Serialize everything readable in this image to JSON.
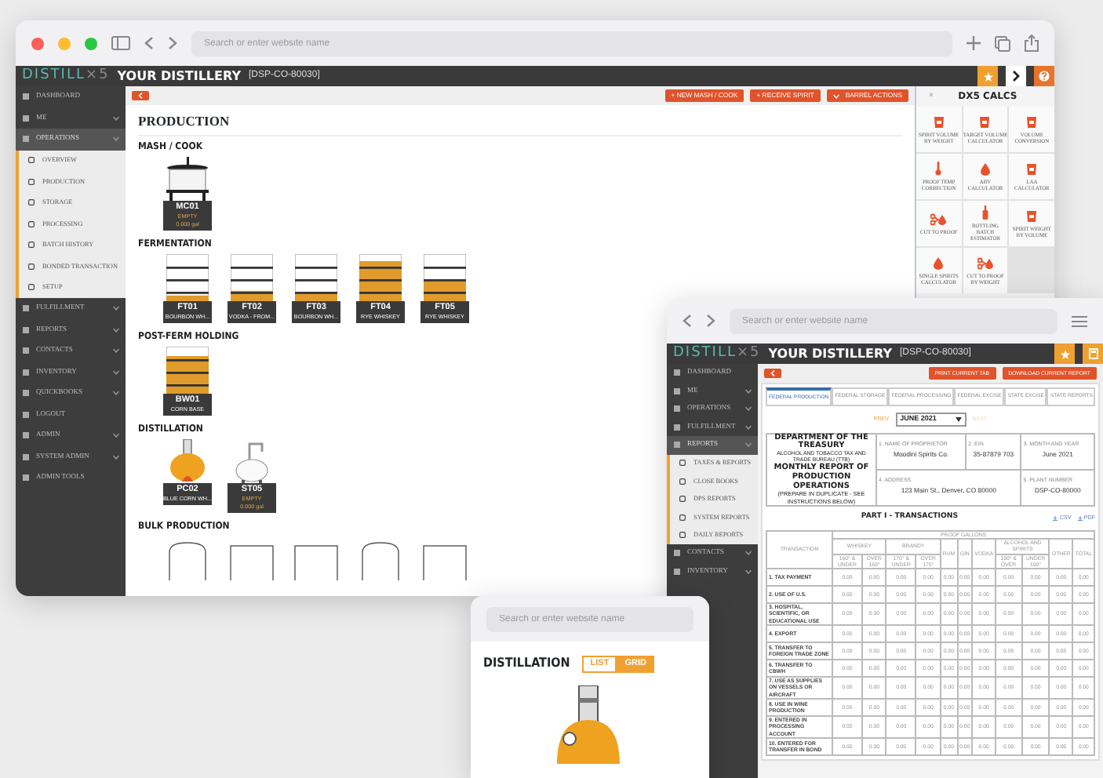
{
  "main_window": {
    "browser": {
      "search_placeholder": "Search or enter website name"
    },
    "header": {
      "logo_word": "DISTILL",
      "logo_suffix": "×5",
      "title": "YOUR DISTILLERY",
      "code": "[DSP-CO-80030]"
    },
    "sidebar": [
      {
        "label": "DASHBOARD",
        "expandable": false,
        "selected": false
      },
      {
        "label": "ME",
        "expandable": true,
        "selected": false
      },
      {
        "label": "OPERATIONS",
        "expandable": true,
        "selected": true,
        "children": [
          {
            "label": "OVERVIEW"
          },
          {
            "label": "PRODUCTION"
          },
          {
            "label": "STORAGE"
          },
          {
            "label": "PROCESSING"
          },
          {
            "label": "BATCH HISTORY"
          },
          {
            "label": "BONDED TRANSACTION"
          },
          {
            "label": "SETUP"
          }
        ]
      },
      {
        "label": "FULFILLMENT",
        "expandable": true,
        "selected": false
      },
      {
        "label": "REPORTS",
        "expandable": true,
        "selected": false
      },
      {
        "label": "CONTACTS",
        "expandable": true,
        "selected": false
      },
      {
        "label": "INVENTORY",
        "expandable": true,
        "selected": false
      },
      {
        "label": "QUICKBOOKS",
        "expandable": true,
        "selected": false
      },
      {
        "label": "LOGOUT",
        "expandable": false,
        "selected": false
      },
      {
        "label": "ADMIN",
        "expandable": true,
        "selected": false
      },
      {
        "label": "SYSTEM ADMIN",
        "expandable": true,
        "selected": false
      },
      {
        "label": "ADMIN TOOLS",
        "expandable": false,
        "selected": false
      }
    ],
    "toolbar": [
      {
        "label": "+ NEW MASH / COOK",
        "kind": "plain"
      },
      {
        "label": "+ RECEIVE SPIRIT",
        "kind": "plain"
      },
      {
        "label": "BARREL ACTIONS",
        "kind": "dropdown"
      }
    ],
    "heading": "PRODUCTION",
    "sections": [
      {
        "title": "MASH / COOK",
        "vessels": [
          {
            "kind": "mash",
            "name": "MC01",
            "lines": [
              "EMPTY",
              "0.000 gal"
            ]
          }
        ]
      },
      {
        "title": "FERMENTATION",
        "vessels": [
          {
            "kind": "fermenter",
            "name": "FT01",
            "lines": [
              "BOURBON WH..."
            ],
            "level": 0.12
          },
          {
            "kind": "fermenter",
            "name": "FT02",
            "lines": [
              "VODKA - FROM..."
            ],
            "level": 0.22
          },
          {
            "kind": "fermenter",
            "name": "FT03",
            "lines": [
              "BOURBON WH..."
            ],
            "level": 0.2
          },
          {
            "kind": "fermenter",
            "name": "FT04",
            "lines": [
              "RYE WHISKEY"
            ],
            "level": 0.85
          },
          {
            "kind": "fermenter",
            "name": "FT05",
            "lines": [
              "RYE WHISKEY"
            ],
            "level": 0.45
          }
        ]
      },
      {
        "title": "POST-FERM HOLDING",
        "vessels": [
          {
            "kind": "fermenter",
            "name": "BW01",
            "lines": [
              "CORN BASE"
            ],
            "level": 0.8
          }
        ]
      },
      {
        "title": "DISTILLATION",
        "vessels": [
          {
            "kind": "pot_still",
            "name": "PC02",
            "lines": [
              "BLUE CORN WH..."
            ]
          },
          {
            "kind": "column_still",
            "name": "ST05",
            "lines": [
              "EMPTY",
              "0.000 gal"
            ]
          }
        ]
      },
      {
        "title": "BULK PRODUCTION",
        "vessels": [
          {
            "kind": "round_tank"
          },
          {
            "kind": "square_tank"
          },
          {
            "kind": "square_tank"
          },
          {
            "kind": "round_tank"
          },
          {
            "kind": "square_tank"
          }
        ]
      }
    ],
    "calcs": {
      "title": "DX5 CALCS",
      "close": "×",
      "items": [
        {
          "label": "SPIRIT VOLUME BY WEIGHT",
          "kind": "glass"
        },
        {
          "label": "TARGET VOLUME CALCULATOR",
          "kind": "glass"
        },
        {
          "label": "VOLUME CONVERSION",
          "kind": "glass"
        },
        {
          "label": "PROOF TEMP CORRECTION",
          "kind": "thermometer"
        },
        {
          "label": "ABV CALCULATOR",
          "kind": "drop"
        },
        {
          "label": "LAA CALCULATOR",
          "kind": "glass"
        },
        {
          "label": "CUT TO PROOF",
          "kind": "scissors"
        },
        {
          "label": "BOTTLING BATCH ESTIMATOR",
          "kind": "bottle"
        },
        {
          "label": "SPIRIT WEIGHT BY VOLUME",
          "kind": "glass"
        },
        {
          "label": "SINGLE SPIRITS CALCULATOR",
          "kind": "drop"
        },
        {
          "label": "CUT TO PROOF BY WEIGHT",
          "kind": "scissors"
        }
      ]
    }
  },
  "report_window": {
    "browser": {
      "search_placeholder": "Search or enter website name"
    },
    "header": {
      "logo_word": "DISTILL",
      "logo_suffix": "×5",
      "title": "YOUR DISTILLERY",
      "code": "[DSP-CO-80030]"
    },
    "sidebar": [
      {
        "label": "DASHBOARD",
        "expandable": false,
        "selected": false
      },
      {
        "label": "ME",
        "expandable": true,
        "selected": false
      },
      {
        "label": "OPERATIONS",
        "expandable": true,
        "selected": false
      },
      {
        "label": "FULFILLMENT",
        "expandable": true,
        "selected": false
      },
      {
        "label": "REPORTS",
        "expandable": true,
        "selected": true,
        "children": [
          {
            "label": "TAXES & REPORTS"
          },
          {
            "label": "CLOSE BOOKS"
          },
          {
            "label": "DPS REPORTS"
          },
          {
            "label": "SYSTEM REPORTS"
          },
          {
            "label": "DAILY REPORTS"
          }
        ]
      },
      {
        "label": "CONTACTS",
        "expandable": true,
        "selected": false
      },
      {
        "label": "INVENTORY",
        "expandable": true,
        "selected": false
      }
    ],
    "buttons": [
      "PRINT CURRENT TAB",
      "DOWNLOAD CURRENT REPORT"
    ],
    "tabs": [
      {
        "label": "FEDERAL PRODUCTION",
        "selected": true
      },
      {
        "label": "FEDERAL STORAGE",
        "selected": false
      },
      {
        "label": "FEDERAL PROCESSING",
        "selected": false
      },
      {
        "label": "FEDERAL EXCISE",
        "selected": false
      },
      {
        "label": "STATE EXCISE",
        "selected": false
      },
      {
        "label": "STATE REPORTS",
        "selected": false
      }
    ],
    "period": {
      "prev": "PREV",
      "value": "JUNE 2021",
      "next": "NEXT"
    },
    "form": {
      "agency": "DEPARTMENT OF THE TREASURY",
      "bureau": "ALCOHOL AND TOBACCO TAX AND TRADE BUREAU (TTB)",
      "title": "MONTHLY REPORT OF PRODUCTION OPERATIONS",
      "note": "(PREPARE IN DUPLICATE - SEE INSTRUCTIONS BELOW)",
      "fields": [
        {
          "label": "1. NAME OF PROPRIETOR",
          "value": "Moodini Spirits Co."
        },
        {
          "label": "2. EIN",
          "value": "35-87879 703"
        },
        {
          "label": "3. MONTH AND YEAR",
          "value": "June 2021"
        },
        {
          "label": "4. ADDRESS",
          "value": "123 Main St., Denver, CO 80000"
        },
        {
          "label": "5. PLANT NUMBER",
          "value": "DSP-CO-80000"
        }
      ]
    },
    "part_title": "PART I - TRANSACTIONS",
    "exports": [
      "CSV",
      "PDF"
    ],
    "table": {
      "group": "PROOF GALLONS",
      "first_column": "TRANSACTION",
      "columns": [
        {
          "label": "WHISKEY",
          "sub": [
            "160° & UNDER",
            "OVER 160°"
          ]
        },
        {
          "label": "BRANDY",
          "sub": [
            "170° & UNDER",
            "OVER 170°"
          ]
        },
        {
          "label": "RUM"
        },
        {
          "label": "GIN"
        },
        {
          "label": "VODKA"
        },
        {
          "label": "ALCOHOL AND SPIRITS",
          "sub": [
            "190° & OVER",
            "UNDER 190°"
          ]
        },
        {
          "label": "OTHER"
        },
        {
          "label": "TOTAL"
        }
      ],
      "rows": [
        {
          "label": "1. TAX PAYMENT",
          "values": [
            "0.00",
            "0.00",
            "0.00",
            "0.00",
            "0.00",
            "0.00",
            "0.00",
            "0.00",
            "0.00",
            "0.00",
            "0.00"
          ]
        },
        {
          "label": "2. USE OF U.S.",
          "values": [
            "0.00",
            "0.00",
            "0.00",
            "0.00",
            "0.00",
            "0.00",
            "0.00",
            "0.00",
            "0.00",
            "0.00",
            "0.00"
          ]
        },
        {
          "label": "3. HOSPITAL, SCIENTIFIC, OR EDUCATIONAL USE",
          "values": [
            "0.00",
            "0.00",
            "0.00",
            "0.00",
            "0.00",
            "0.00",
            "0.00",
            "0.00",
            "0.00",
            "0.00",
            "0.00"
          ]
        },
        {
          "label": "4. EXPORT",
          "values": [
            "0.00",
            "0.00",
            "0.00",
            "0.00",
            "0.00",
            "0.00",
            "0.00",
            "0.00",
            "0.00",
            "0.00",
            "0.00"
          ]
        },
        {
          "label": "5. TRANSFER TO FOREIGN TRADE ZONE",
          "values": [
            "0.00",
            "0.00",
            "0.00",
            "0.00",
            "0.00",
            "0.00",
            "0.00",
            "0.00",
            "0.00",
            "0.00",
            "0.00"
          ]
        },
        {
          "label": "6. TRANSFER TO CBWH",
          "values": [
            "0.00",
            "0.00",
            "0.00",
            "0.00",
            "0.00",
            "0.00",
            "0.00",
            "0.00",
            "0.00",
            "0.00",
            "0.00"
          ]
        },
        {
          "label": "7. USE AS SUPPLIES ON VESSELS OR AIRCRAFT",
          "values": [
            "0.00",
            "0.00",
            "0.00",
            "0.00",
            "0.00",
            "0.00",
            "0.00",
            "0.00",
            "0.00",
            "0.00",
            "0.00"
          ]
        },
        {
          "label": "8. USE IN WINE PRODUCTION",
          "values": [
            "0.00",
            "0.00",
            "0.00",
            "0.00",
            "0.00",
            "0.00",
            "0.00",
            "0.00",
            "0.00",
            "0.00",
            "0.00"
          ]
        },
        {
          "label": "9. ENTERED IN PROCESSING ACCOUNT",
          "values": [
            "0.00",
            "0.00",
            "0.00",
            "0.00",
            "0.00",
            "0.00",
            "0.00",
            "0.00",
            "0.00",
            "0.00",
            "0.00"
          ]
        },
        {
          "label": "10. ENTERED FOR TRANSFER IN BOND",
          "values": [
            "0.00",
            "0.00",
            "0.00",
            "0.00",
            "0.00",
            "0.00",
            "0.00",
            "0.00",
            "0.00",
            "0.00",
            "0.00"
          ]
        }
      ]
    }
  },
  "distillation_window": {
    "browser": {
      "search_placeholder": "Search or enter website name"
    },
    "heading": "DISTILLATION",
    "views": [
      {
        "label": "LIST",
        "selected": false
      },
      {
        "label": "GRID",
        "selected": true
      }
    ]
  }
}
